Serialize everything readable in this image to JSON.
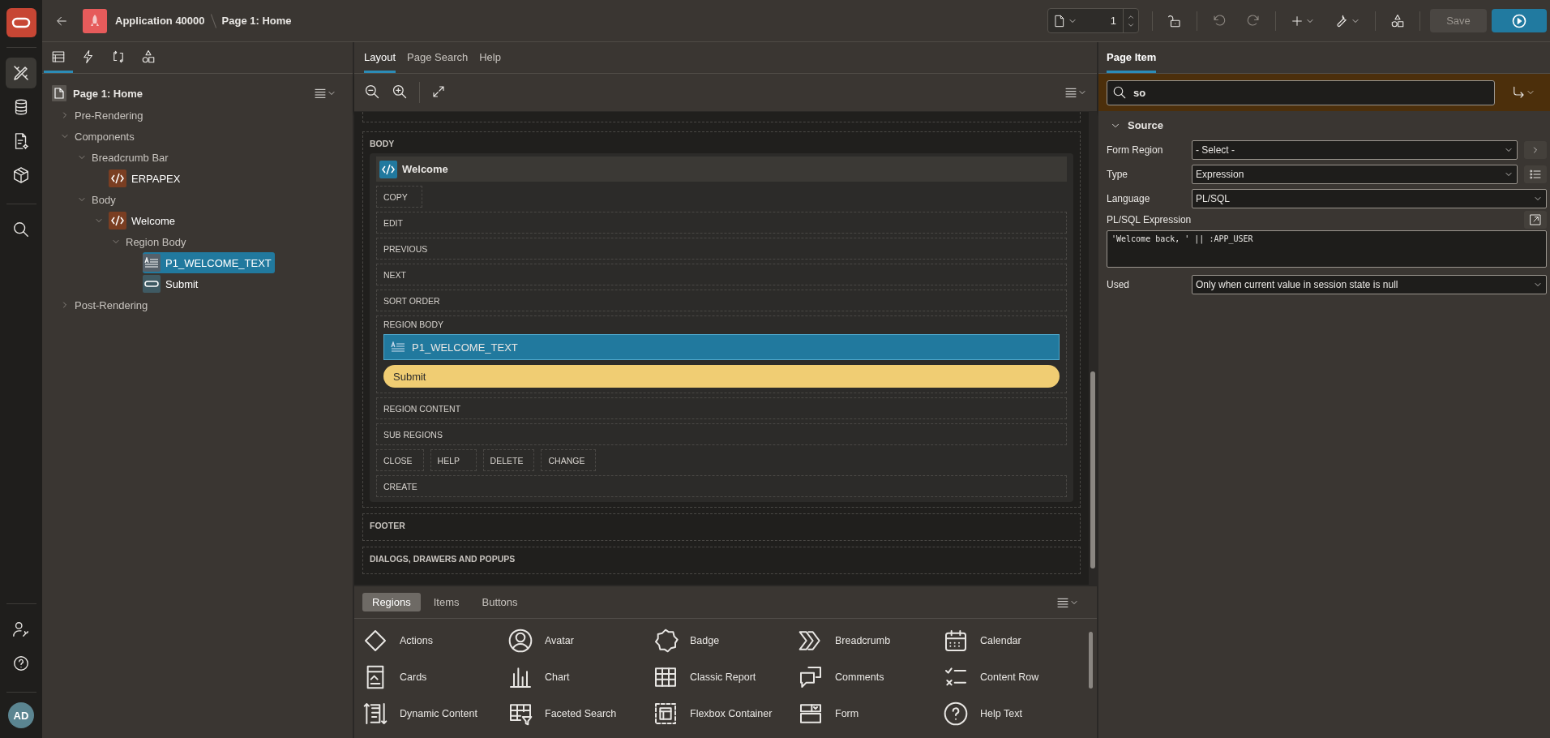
{
  "header": {
    "app_name": "Application 40000",
    "page_name": "Page 1: Home",
    "page_number": "1",
    "save_label": "Save"
  },
  "user": {
    "initials": "AD"
  },
  "tree": {
    "root": "Page 1: Home",
    "nodes": [
      {
        "label": "Pre-Rendering",
        "kind": "group",
        "expanded": false,
        "selected": false
      },
      {
        "label": "Components",
        "kind": "group",
        "expanded": true,
        "selected": false,
        "children": [
          {
            "label": "Breadcrumb Bar",
            "kind": "group",
            "expanded": true,
            "selected": false,
            "children": [
              {
                "label": "ERPAPEX",
                "kind": "region",
                "selected": false
              }
            ]
          },
          {
            "label": "Body",
            "kind": "group",
            "expanded": true,
            "selected": false,
            "children": [
              {
                "label": "Welcome",
                "kind": "region",
                "expanded": true,
                "selected": false,
                "children": [
                  {
                    "label": "Region Body",
                    "kind": "group",
                    "expanded": true,
                    "selected": false,
                    "children": [
                      {
                        "label": "P1_WELCOME_TEXT",
                        "kind": "item",
                        "selected": true
                      },
                      {
                        "label": "Submit",
                        "kind": "button",
                        "selected": false
                      }
                    ]
                  }
                ]
              }
            ]
          }
        ]
      },
      {
        "label": "Post-Rendering",
        "kind": "group",
        "expanded": false,
        "selected": false
      }
    ]
  },
  "center_tabs": [
    {
      "label": "Layout",
      "selected": true
    },
    {
      "label": "Page Search",
      "selected": false
    },
    {
      "label": "Help",
      "selected": false
    }
  ],
  "layout": {
    "sections": [
      {
        "label": "BODY",
        "region": {
          "title": "Welcome",
          "rows": [
            {
              "kind": "buttons",
              "labels": [
                "COPY"
              ]
            },
            {
              "kind": "position",
              "label": "EDIT"
            },
            {
              "kind": "position",
              "label": "PREVIOUS"
            },
            {
              "kind": "position",
              "label": "NEXT"
            },
            {
              "kind": "position",
              "label": "SORT ORDER"
            },
            {
              "kind": "body",
              "label": "REGION BODY",
              "components": [
                {
                  "kind": "item",
                  "label": "P1_WELCOME_TEXT",
                  "selected": true
                },
                {
                  "kind": "button",
                  "label": "Submit",
                  "selected": false
                }
              ]
            },
            {
              "kind": "position",
              "label": "REGION CONTENT"
            },
            {
              "kind": "position",
              "label": "SUB REGIONS"
            },
            {
              "kind": "buttons",
              "labels": [
                "CLOSE",
                "HELP",
                "DELETE",
                "CHANGE"
              ]
            },
            {
              "kind": "position",
              "label": "CREATE"
            }
          ]
        }
      },
      {
        "label": "FOOTER"
      },
      {
        "label": "DIALOGS, DRAWERS AND POPUPS"
      }
    ]
  },
  "gallery": {
    "tabs": [
      {
        "label": "Regions",
        "selected": true
      },
      {
        "label": "Items",
        "selected": false
      },
      {
        "label": "Buttons",
        "selected": false
      }
    ],
    "items": [
      "Actions",
      "Avatar",
      "Badge",
      "Breadcrumb",
      "Calendar",
      "Cards",
      "Chart",
      "Classic Report",
      "Comments",
      "Content Row",
      "Dynamic Content",
      "Faceted Search",
      "Flexbox Container",
      "Form",
      "Help Text"
    ]
  },
  "properties": {
    "tab": "Page Item",
    "search_value": "so",
    "section": {
      "title": "Source",
      "expanded": true
    },
    "fields": [
      {
        "label": "Form Region",
        "kind": "lookup",
        "value": "- Select -"
      },
      {
        "label": "Type",
        "kind": "choice",
        "value": "Expression"
      },
      {
        "label": "Language",
        "kind": "select",
        "value": "PL/SQL"
      },
      {
        "label": "PL/SQL Expression",
        "kind": "code",
        "value": "'Welcome back, ' || :APP_USER"
      },
      {
        "label": "Used",
        "kind": "select",
        "value": "Only when current value in session state is null"
      }
    ]
  }
}
